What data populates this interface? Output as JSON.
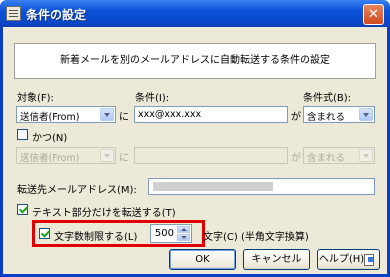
{
  "window": {
    "title": "条件の設定",
    "close_glyph": "✕"
  },
  "description": "新着メールを別のメールアドレスに自動転送する条件の設定",
  "row1": {
    "target_label": "対象(F):",
    "target_value": "送信者(From)",
    "ni": "に",
    "condition_label": "条件(I):",
    "condition_value": "xxx@xxx.xxx",
    "ga": "が",
    "formula_label": "条件式(B):",
    "formula_value": "含まれる"
  },
  "and_label": "かつ(N)",
  "row2": {
    "target_value": "送信者(From)",
    "ni": "に",
    "ga": "が",
    "formula_value": "含まれる"
  },
  "forward_label": "転送先メールアドレス(M):",
  "text_only_label": "テキスト部分だけを転送する(T)",
  "limit": {
    "label": "文字数制限する(L)",
    "value": "500",
    "unit_label": "文字(C) (半角文字換算)"
  },
  "buttons": {
    "ok": "OK",
    "cancel": "キャンセル",
    "help": "ヘルプ(H)"
  }
}
